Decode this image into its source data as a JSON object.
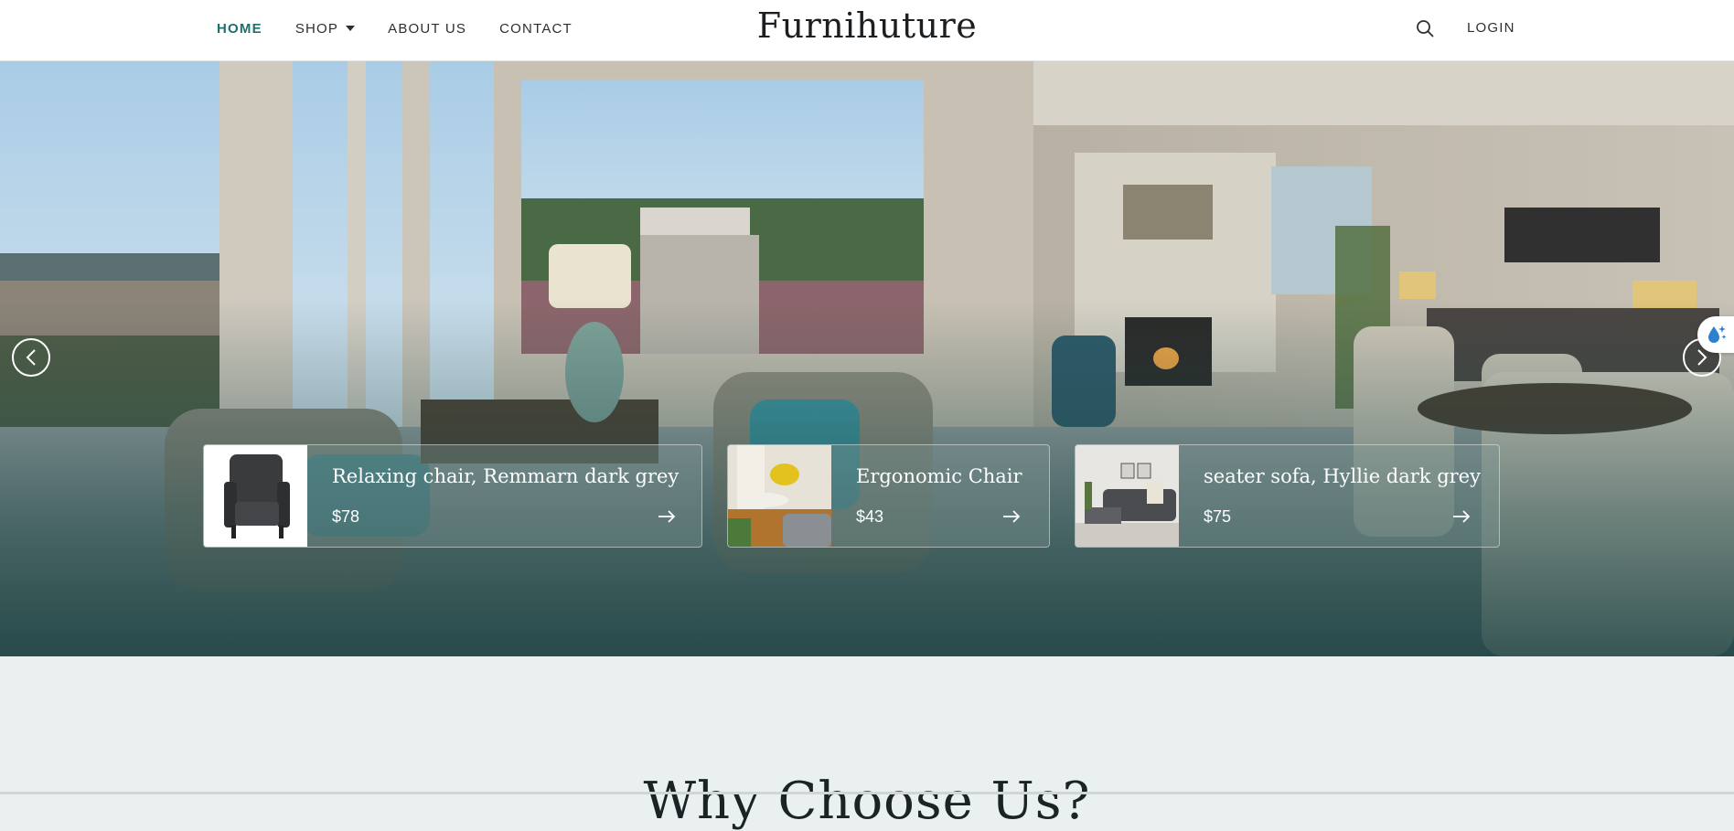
{
  "header": {
    "logo": "Furnihuture",
    "nav": [
      {
        "label": "HOME",
        "active": true
      },
      {
        "label": "SHOP",
        "has_dropdown": true
      },
      {
        "label": "ABOUT US"
      },
      {
        "label": "CONTACT"
      }
    ],
    "search_icon": "search-icon",
    "login_label": "LOGIN"
  },
  "hero": {
    "prev_icon": "chevron-left-icon",
    "next_icon": "chevron-right-icon",
    "widget_icon": "water-drop-icon"
  },
  "products": [
    {
      "title": "Relaxing chair, Remmarn dark grey",
      "price": "$78"
    },
    {
      "title": "Ergonomic Chair",
      "price": "$43"
    },
    {
      "title": "seater sofa, Hyllie dark grey",
      "price": "$75"
    }
  ],
  "section": {
    "title": "Why Choose Us?"
  },
  "colors": {
    "accent": "#1f6f6b",
    "text": "#2b2f33",
    "section_bg": "#e9f0ef"
  }
}
